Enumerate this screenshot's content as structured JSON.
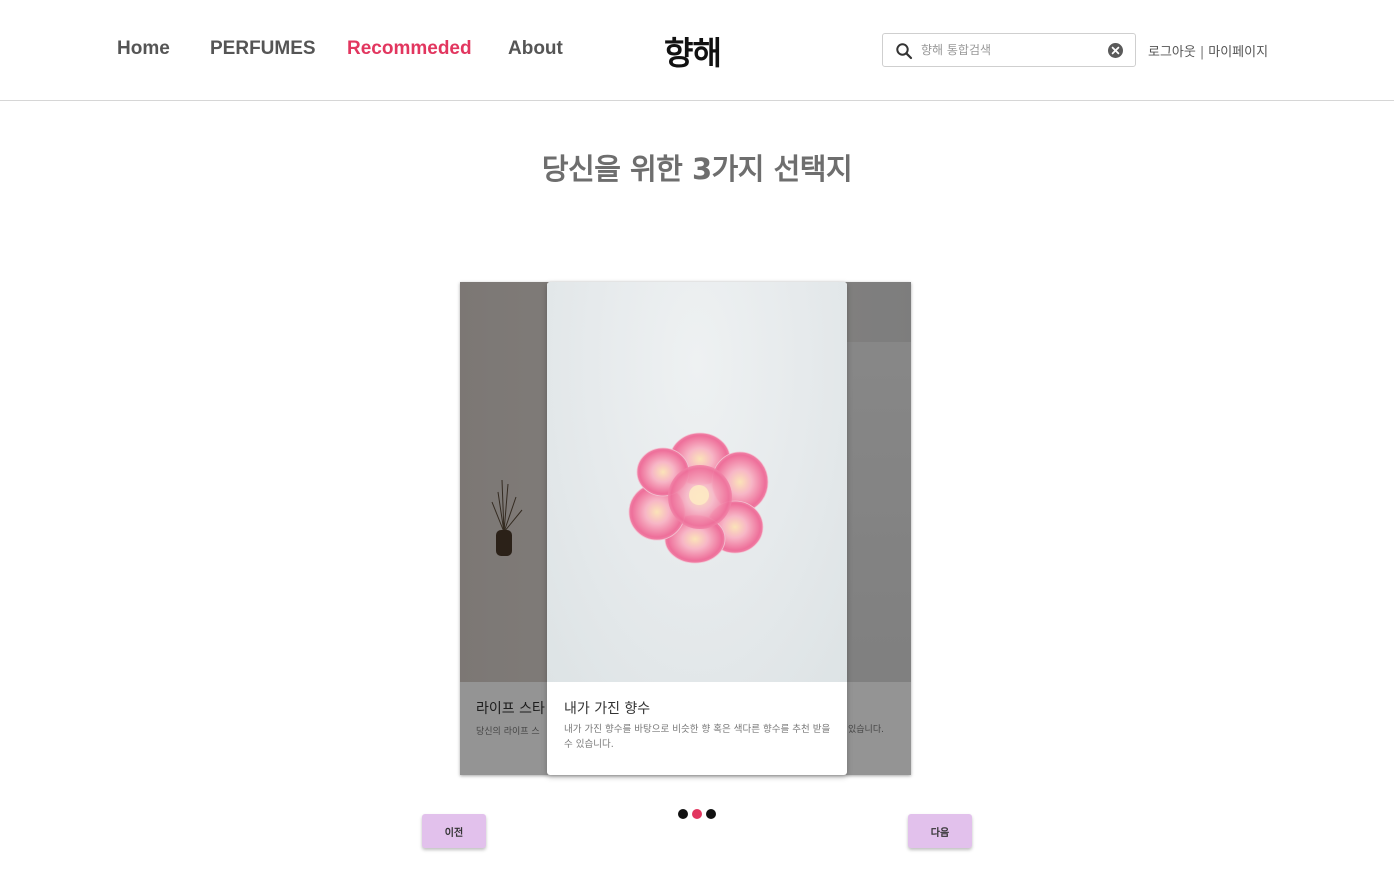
{
  "nav": {
    "items": [
      {
        "label": "Home",
        "active": false
      },
      {
        "label": "PERFUMES",
        "active": false
      },
      {
        "label": "Recommeded",
        "active": true
      },
      {
        "label": "About",
        "active": false
      }
    ],
    "logo": "향해"
  },
  "search": {
    "placeholder": "향해 통합검색",
    "value": ""
  },
  "account": {
    "logout": "로그아웃",
    "separator": "|",
    "mypage": "마이페이지"
  },
  "main": {
    "heading": "당신을 위한 3가지 선택지"
  },
  "carousel": {
    "back_card": {
      "title": "라이프 스타",
      "desc_left": "당신의 라이프 스",
      "desc_right": "있습니다."
    },
    "front_card": {
      "title": "내가 가진 향수",
      "desc": "내가 가진 향수를 바탕으로 비슷한 향 혹은 색다른 향수를 추천 받을 수 있습니다."
    },
    "active_index": 1,
    "count": 3
  },
  "controls": {
    "prev_label": "이전",
    "next_label": "다음"
  },
  "colors": {
    "accent": "#e2365f",
    "button": "#e2c1ec"
  }
}
